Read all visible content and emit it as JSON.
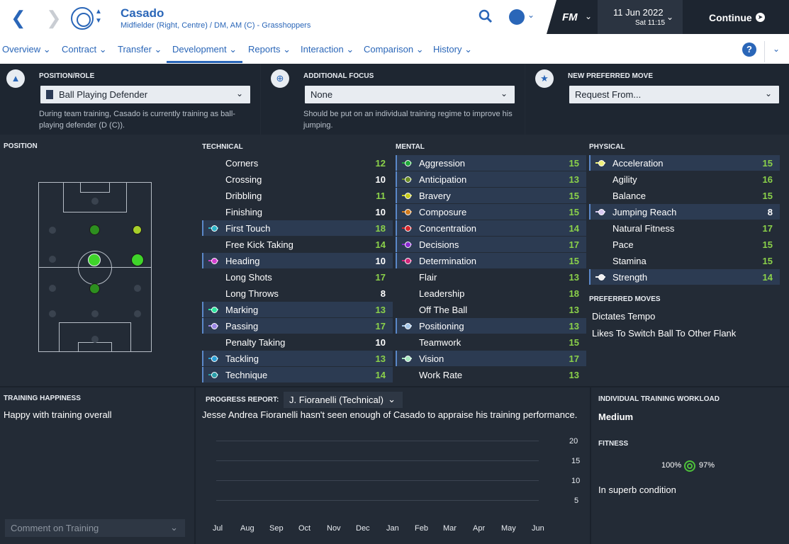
{
  "header": {
    "player_name": "Casado",
    "player_subtitle": "Midfielder (Right, Centre) / DM, AM (C) - Grasshoppers",
    "logo": "FM",
    "date": "11 Jun 2022",
    "day_time": "Sat 11:15",
    "continue_label": "Continue"
  },
  "tabs": [
    {
      "label": "Overview"
    },
    {
      "label": "Contract"
    },
    {
      "label": "Transfer"
    },
    {
      "label": "Development",
      "active": true
    },
    {
      "label": "Reports"
    },
    {
      "label": "Interaction"
    },
    {
      "label": "Comparison"
    },
    {
      "label": "History"
    }
  ],
  "top": {
    "position_role": {
      "title": "POSITION/ROLE",
      "value": "Ball Playing Defender",
      "desc": "During team training, Casado is currently training as ball-playing defender (D (C))."
    },
    "additional_focus": {
      "title": "ADDITIONAL FOCUS",
      "value": "None",
      "desc": "Should be put on an individual training regime to improve his jumping."
    },
    "new_move": {
      "title": "NEW PREFERRED MOVE",
      "value": "Request From..."
    }
  },
  "position_label": "POSITION",
  "technical": {
    "title": "TECHNICAL",
    "items": [
      {
        "name": "Corners",
        "value": "12",
        "hl": false
      },
      {
        "name": "Crossing",
        "value": "10",
        "hl": false
      },
      {
        "name": "Dribbling",
        "value": "11",
        "hl": false
      },
      {
        "name": "Finishing",
        "value": "10",
        "hl": false
      },
      {
        "name": "First Touch",
        "value": "18",
        "hl": true,
        "dot": "#2bb3c8"
      },
      {
        "name": "Free Kick Taking",
        "value": "14",
        "hl": false
      },
      {
        "name": "Heading",
        "value": "10",
        "hl": true,
        "dot": "#d33fd0"
      },
      {
        "name": "Long Shots",
        "value": "17",
        "hl": false
      },
      {
        "name": "Long Throws",
        "value": "8",
        "hl": false
      },
      {
        "name": "Marking",
        "value": "13",
        "hl": true,
        "dot": "#2ee6a0"
      },
      {
        "name": "Passing",
        "value": "17",
        "hl": true,
        "dot": "#9a86e6"
      },
      {
        "name": "Penalty Taking",
        "value": "10",
        "hl": false
      },
      {
        "name": "Tackling",
        "value": "13",
        "hl": true,
        "dot": "#2a9fd6"
      },
      {
        "name": "Technique",
        "value": "14",
        "hl": true,
        "dot": "#2a9ea8"
      }
    ]
  },
  "mental": {
    "title": "MENTAL",
    "items": [
      {
        "name": "Aggression",
        "value": "15",
        "hl": true,
        "dot": "#1fa83a"
      },
      {
        "name": "Anticipation",
        "value": "13",
        "hl": true,
        "dot": "#6c8c26"
      },
      {
        "name": "Bravery",
        "value": "15",
        "hl": true,
        "dot": "#c7c91a"
      },
      {
        "name": "Composure",
        "value": "15",
        "hl": true,
        "dot": "#d07a1d"
      },
      {
        "name": "Concentration",
        "value": "14",
        "hl": true,
        "dot": "#d8262a"
      },
      {
        "name": "Decisions",
        "value": "17",
        "hl": true,
        "dot": "#8a2ad0"
      },
      {
        "name": "Determination",
        "value": "15",
        "hl": true,
        "dot": "#d0267a"
      },
      {
        "name": "Flair",
        "value": "13",
        "hl": false
      },
      {
        "name": "Leadership",
        "value": "18",
        "hl": false
      },
      {
        "name": "Off The Ball",
        "value": "13",
        "hl": false
      },
      {
        "name": "Positioning",
        "value": "13",
        "hl": true,
        "dot": "#a6c7e8"
      },
      {
        "name": "Teamwork",
        "value": "15",
        "hl": false
      },
      {
        "name": "Vision",
        "value": "17",
        "hl": true,
        "dot": "#a8e8c0"
      },
      {
        "name": "Work Rate",
        "value": "13",
        "hl": false
      }
    ]
  },
  "physical": {
    "title": "PHYSICAL",
    "items": [
      {
        "name": "Acceleration",
        "value": "15",
        "hl": true,
        "dot": "#f0f07a"
      },
      {
        "name": "Agility",
        "value": "16",
        "hl": false
      },
      {
        "name": "Balance",
        "value": "15",
        "hl": false
      },
      {
        "name": "Jumping Reach",
        "value": "8",
        "hl": true,
        "dot": "#d8c8f0"
      },
      {
        "name": "Natural Fitness",
        "value": "17",
        "hl": false
      },
      {
        "name": "Pace",
        "value": "15",
        "hl": false
      },
      {
        "name": "Stamina",
        "value": "15",
        "hl": false
      },
      {
        "name": "Strength",
        "value": "14",
        "hl": true,
        "dot": "#f0f0f0"
      }
    ]
  },
  "preferred_moves": {
    "title": "PREFERRED MOVES",
    "items": [
      "Dictates Tempo",
      "Likes To Switch Ball To Other Flank"
    ]
  },
  "training_happiness": {
    "title": "TRAINING HAPPINESS",
    "text": "Happy with training overall",
    "comment_label": "Comment on Training"
  },
  "progress": {
    "title": "PROGRESS REPORT:",
    "coach": "J. Fioranelli (Technical)",
    "text": "Jesse Andrea Fioranelli hasn't seen enough of Casado to appraise his training performance.",
    "y_ticks": [
      "20",
      "15",
      "10",
      "5"
    ],
    "x_ticks": [
      "Jul",
      "Aug",
      "Sep",
      "Oct",
      "Nov",
      "Dec",
      "Jan",
      "Feb",
      "Mar",
      "Apr",
      "May",
      "Jun"
    ]
  },
  "workload": {
    "title": "INDIVIDUAL TRAINING WORKLOAD",
    "value": "Medium",
    "fitness_title": "FITNESS",
    "fitness_a": "100%",
    "fitness_b": "97%",
    "condition": "In superb condition"
  },
  "colors": {
    "value_green": "#8bd14a",
    "value_white": "#ffffff",
    "accent_blue": "#2a66b8"
  }
}
